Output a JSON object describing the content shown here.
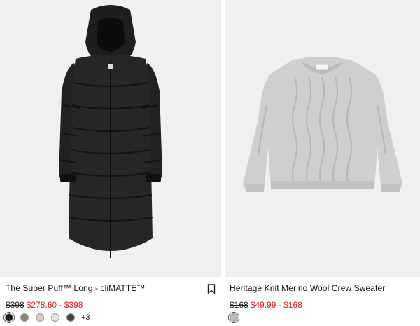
{
  "products": [
    {
      "title": "The Super Puff™ Long - cliMATTE™",
      "price_original": "$398",
      "price_sale": "$278.60 - $398",
      "swatches": [
        {
          "name": "Black",
          "color": "#1c1c1c"
        },
        {
          "name": "Taupe",
          "color": "#8b8478"
        },
        {
          "name": "Blush",
          "color": "#dcc9c2"
        },
        {
          "name": "Cream",
          "color": "#e6e3da"
        },
        {
          "name": "Olive",
          "color": "#3f4536"
        }
      ],
      "more_swatches": "+3"
    },
    {
      "title": "Heritage Knit Merino Wool Crew Sweater",
      "price_original": "$168",
      "price_sale": "$49.99 - $168",
      "swatches": [
        {
          "name": "Heather Grey",
          "color": "#b9b9b9"
        }
      ]
    }
  ],
  "colors": {
    "sale": "#d3222a",
    "image_background": "#f0f0f0"
  },
  "icons": {
    "bookmark": "bookmark-icon"
  }
}
